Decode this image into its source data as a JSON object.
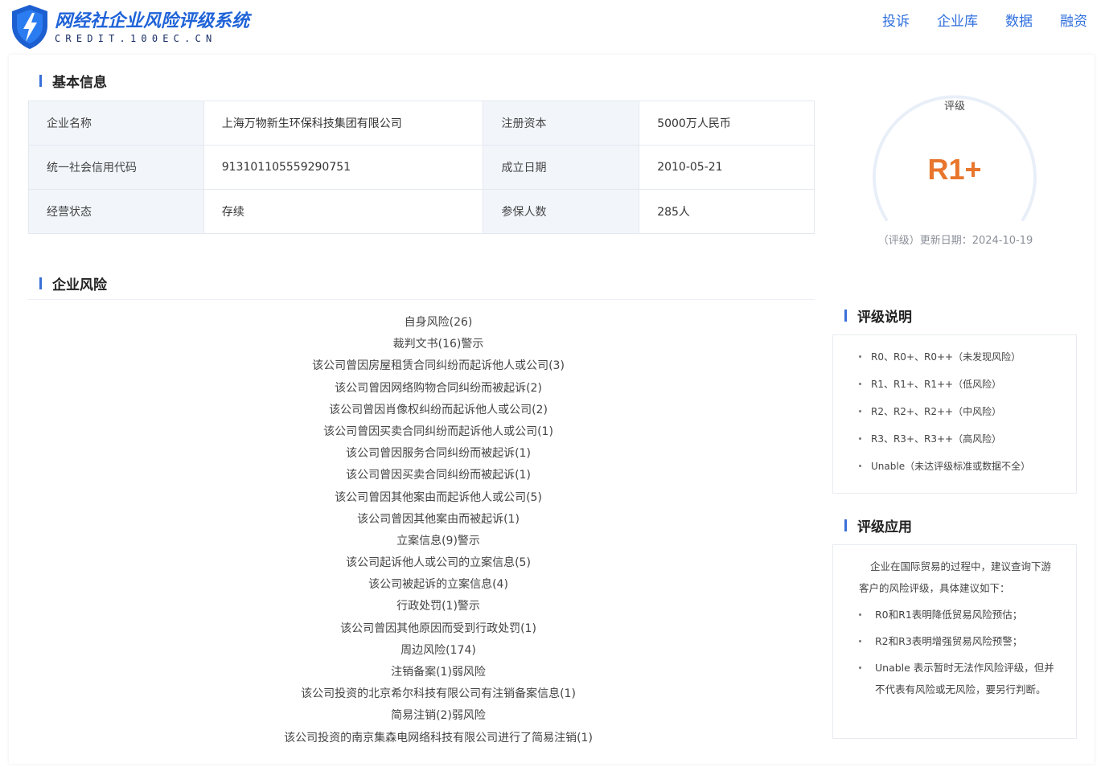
{
  "header": {
    "logo_title": "网经社企业风险评级系统",
    "logo_subtitle": "CREDIT.100EC.CN",
    "nav": [
      "投诉",
      "企业库",
      "数据",
      "融资"
    ]
  },
  "basic_info": {
    "title": "基本信息",
    "rows": [
      [
        "企业名称",
        "上海万物新生环保科技集团有限公司",
        "注册资本",
        "5000万人民币"
      ],
      [
        "统一社会信用代码",
        "913101105559290751",
        "成立日期",
        "2010-05-21"
      ],
      [
        "经营状态",
        "存续",
        "参保人数",
        "285人"
      ]
    ]
  },
  "rating": {
    "label": "评级",
    "value": "R1+",
    "update": "（评级）更新日期：2024-10-19",
    "value_color": "#e8762c"
  },
  "risk": {
    "title": "企业风险",
    "items": [
      "自身风险(26)",
      "裁判文书(16)警示",
      "该公司曾因房屋租赁合同纠纷而起诉他人或公司(3)",
      "该公司曾因网络购物合同纠纷而被起诉(2)",
      "该公司曾因肖像权纠纷而起诉他人或公司(2)",
      "该公司曾因买卖合同纠纷而起诉他人或公司(1)",
      "该公司曾因服务合同纠纷而被起诉(1)",
      "该公司曾因买卖合同纠纷而被起诉(1)",
      "该公司曾因其他案由而起诉他人或公司(5)",
      "该公司曾因其他案由而被起诉(1)",
      "立案信息(9)警示",
      "该公司起诉他人或公司的立案信息(5)",
      "该公司被起诉的立案信息(4)",
      "行政处罚(1)警示",
      "该公司曾因其他原因而受到行政处罚(1)",
      "周边风险(174)",
      "注销备案(1)弱风险",
      "该公司投资的北京希尔科技有限公司有注销备案信息(1)",
      "简易注销(2)弱风险",
      "该公司投资的南京集森电网络科技有限公司进行了简易注销(1)"
    ]
  },
  "rating_legend": {
    "title": "评级说明",
    "items": [
      "R0、R0+、R0++（未发现风险）",
      "R1、R1+、R1++（低风险）",
      "R2、R2+、R2++（中风险）",
      "R3、R3+、R3++（高风险）",
      "Unable（未达评级标准或数据不全）"
    ]
  },
  "rating_application": {
    "title": "评级应用",
    "intro": "企业在国际贸易的过程中，建议查询下游客户的风险评级，具体建议如下：",
    "items": [
      "R0和R1表明降低贸易风险预估；",
      "R2和R3表明增强贸易风险预警；",
      "Unable 表示暂时无法作风险评级，但并不代表有风险或无风险，要另行判断。"
    ]
  }
}
